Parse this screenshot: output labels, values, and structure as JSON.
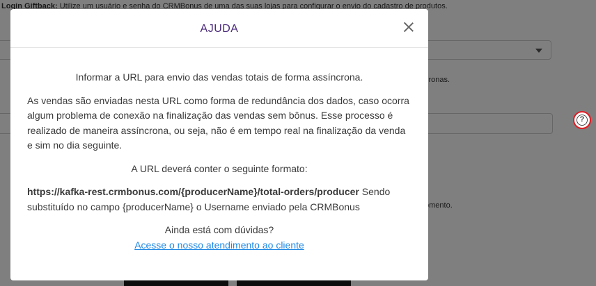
{
  "background": {
    "top_text_bold": "Login Giftback:",
    "top_text": " Utilize um usuário e senha do CRMBonus de uma das suas lojas para configurar o envio do cadastro de produtos.",
    "help_text_1": "cronas.",
    "help_text_2": "omento.",
    "help_icon_symbol": "?"
  },
  "modal": {
    "title": "AJUDA",
    "intro": "Informar a URL para envio das vendas totais de forma assíncrona.",
    "description": "As vendas são enviadas nesta URL como forma de redundância dos dados, caso ocorra algum problema de conexão na finalização das vendas sem bônus. Esse processo é realizado de maneira assíncrona, ou seja, não é em tempo real na finalização da venda e sim no dia seguinte.",
    "format_title": "A URL deverá conter o seguinte formato:",
    "format_url": "https://kafka-rest.crmbonus.com/{producerName}/total-orders/producer",
    "format_note": " Sendo substituído no campo {producerName} o Username enviado pela CRMBonus",
    "doubts": "Ainda está com dúvidas?",
    "support_link": "Acesse o nosso atendimento ao cliente"
  },
  "colors": {
    "title": "#4a2a7a",
    "link": "#1e88e5",
    "help_ring": "#e31b23"
  }
}
